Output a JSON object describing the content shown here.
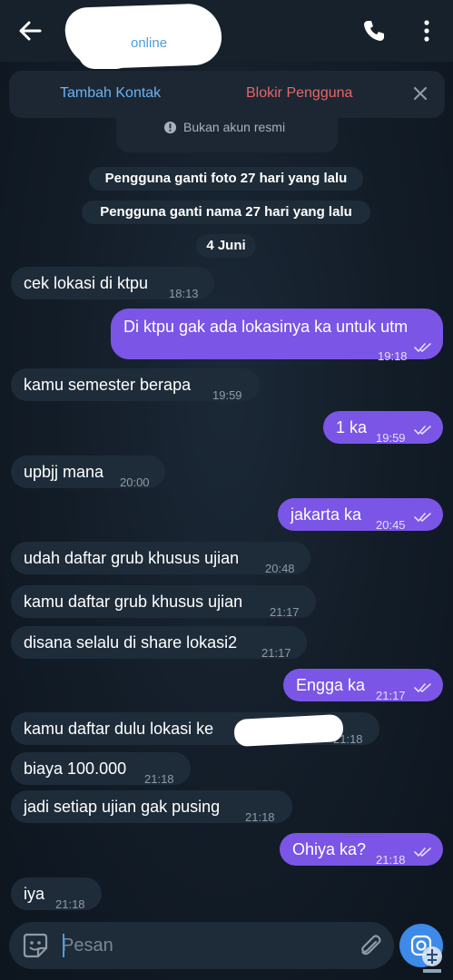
{
  "header": {
    "status": "online"
  },
  "action_bar": {
    "add_contact": "Tambah Kontak",
    "block_user": "Blokir Pengguna",
    "official_notice": "Bukan akun resmi"
  },
  "service_messages": [
    "Pengguna ganti foto 27 hari yang lalu",
    "Pengguna ganti nama 27 hari yang lalu",
    "4 Juni"
  ],
  "messages": [
    {
      "dir": "in",
      "text": "cek lokasi di ktpu",
      "time": "18:13"
    },
    {
      "dir": "out",
      "text": "Di ktpu gak ada lokasinya ka untuk utm",
      "time": "19:18"
    },
    {
      "dir": "in",
      "text": "kamu semester berapa",
      "time": "19:59"
    },
    {
      "dir": "out",
      "text": "1 ka",
      "time": "19:59"
    },
    {
      "dir": "in",
      "text": "upbjj mana",
      "time": "20:00"
    },
    {
      "dir": "out",
      "text": "jakarta ka",
      "time": "20:45"
    },
    {
      "dir": "in",
      "text": "udah daftar grub khusus ujian",
      "time": "20:48"
    },
    {
      "dir": "in",
      "text": "kamu daftar grub khusus ujian",
      "time": "21:17"
    },
    {
      "dir": "in",
      "text": "disana selalu di share lokasi2",
      "time": "21:17"
    },
    {
      "dir": "out",
      "text": "Engga ka",
      "time": "21:17"
    },
    {
      "dir": "in",
      "text": "kamu daftar dulu lokasi ke",
      "time": "21:18"
    },
    {
      "dir": "in",
      "text": "biaya 100.000",
      "time": "21:18"
    },
    {
      "dir": "in",
      "text": "jadi setiap ujian gak pusing",
      "time": "21:18"
    },
    {
      "dir": "out",
      "text": "Ohiya ka?",
      "time": "21:18"
    },
    {
      "dir": "in",
      "text": "iya",
      "time": "21:18"
    }
  ],
  "composer": {
    "placeholder": "Pesan"
  },
  "icons": {
    "back": "arrow-left-icon",
    "call": "phone-icon",
    "more": "more-vertical-icon",
    "close": "close-icon",
    "info": "info-icon",
    "read": "double-check-icon",
    "emoji": "sticker-icon",
    "attach": "paperclip-icon",
    "camera": "camera-icon"
  },
  "colors": {
    "outgoing_bubble": "#7b55e6",
    "outgoing_bubble_alt": "#3d8ae8",
    "incoming_bubble": "#1e2c3a",
    "accent": "#6ab3f3",
    "danger": "#e5666a"
  }
}
